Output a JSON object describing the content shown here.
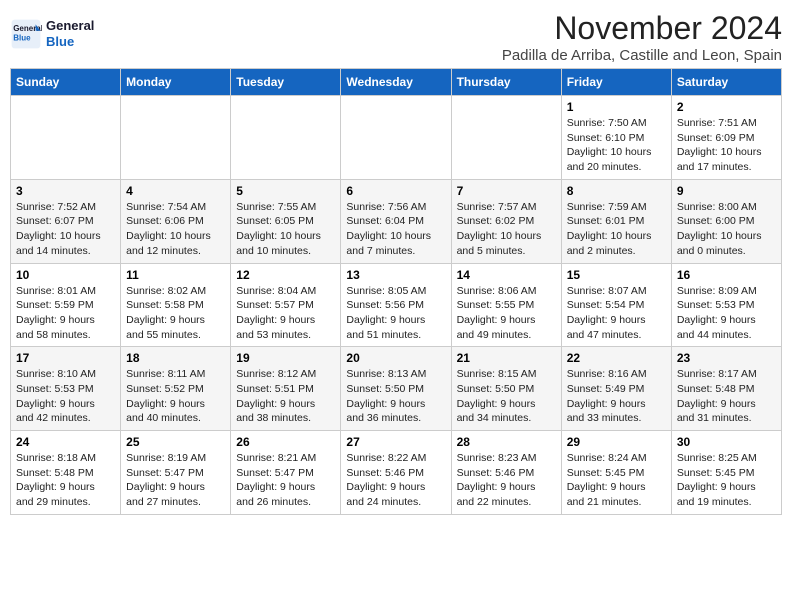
{
  "header": {
    "logo_line1": "General",
    "logo_line2": "Blue",
    "month_title": "November 2024",
    "location": "Padilla de Arriba, Castille and Leon, Spain"
  },
  "weekdays": [
    "Sunday",
    "Monday",
    "Tuesday",
    "Wednesday",
    "Thursday",
    "Friday",
    "Saturday"
  ],
  "weeks": [
    [
      {
        "day": "",
        "info": ""
      },
      {
        "day": "",
        "info": ""
      },
      {
        "day": "",
        "info": ""
      },
      {
        "day": "",
        "info": ""
      },
      {
        "day": "",
        "info": ""
      },
      {
        "day": "1",
        "info": "Sunrise: 7:50 AM\nSunset: 6:10 PM\nDaylight: 10 hours\nand 20 minutes."
      },
      {
        "day": "2",
        "info": "Sunrise: 7:51 AM\nSunset: 6:09 PM\nDaylight: 10 hours\nand 17 minutes."
      }
    ],
    [
      {
        "day": "3",
        "info": "Sunrise: 7:52 AM\nSunset: 6:07 PM\nDaylight: 10 hours\nand 14 minutes."
      },
      {
        "day": "4",
        "info": "Sunrise: 7:54 AM\nSunset: 6:06 PM\nDaylight: 10 hours\nand 12 minutes."
      },
      {
        "day": "5",
        "info": "Sunrise: 7:55 AM\nSunset: 6:05 PM\nDaylight: 10 hours\nand 10 minutes."
      },
      {
        "day": "6",
        "info": "Sunrise: 7:56 AM\nSunset: 6:04 PM\nDaylight: 10 hours\nand 7 minutes."
      },
      {
        "day": "7",
        "info": "Sunrise: 7:57 AM\nSunset: 6:02 PM\nDaylight: 10 hours\nand 5 minutes."
      },
      {
        "day": "8",
        "info": "Sunrise: 7:59 AM\nSunset: 6:01 PM\nDaylight: 10 hours\nand 2 minutes."
      },
      {
        "day": "9",
        "info": "Sunrise: 8:00 AM\nSunset: 6:00 PM\nDaylight: 10 hours\nand 0 minutes."
      }
    ],
    [
      {
        "day": "10",
        "info": "Sunrise: 8:01 AM\nSunset: 5:59 PM\nDaylight: 9 hours\nand 58 minutes."
      },
      {
        "day": "11",
        "info": "Sunrise: 8:02 AM\nSunset: 5:58 PM\nDaylight: 9 hours\nand 55 minutes."
      },
      {
        "day": "12",
        "info": "Sunrise: 8:04 AM\nSunset: 5:57 PM\nDaylight: 9 hours\nand 53 minutes."
      },
      {
        "day": "13",
        "info": "Sunrise: 8:05 AM\nSunset: 5:56 PM\nDaylight: 9 hours\nand 51 minutes."
      },
      {
        "day": "14",
        "info": "Sunrise: 8:06 AM\nSunset: 5:55 PM\nDaylight: 9 hours\nand 49 minutes."
      },
      {
        "day": "15",
        "info": "Sunrise: 8:07 AM\nSunset: 5:54 PM\nDaylight: 9 hours\nand 47 minutes."
      },
      {
        "day": "16",
        "info": "Sunrise: 8:09 AM\nSunset: 5:53 PM\nDaylight: 9 hours\nand 44 minutes."
      }
    ],
    [
      {
        "day": "17",
        "info": "Sunrise: 8:10 AM\nSunset: 5:53 PM\nDaylight: 9 hours\nand 42 minutes."
      },
      {
        "day": "18",
        "info": "Sunrise: 8:11 AM\nSunset: 5:52 PM\nDaylight: 9 hours\nand 40 minutes."
      },
      {
        "day": "19",
        "info": "Sunrise: 8:12 AM\nSunset: 5:51 PM\nDaylight: 9 hours\nand 38 minutes."
      },
      {
        "day": "20",
        "info": "Sunrise: 8:13 AM\nSunset: 5:50 PM\nDaylight: 9 hours\nand 36 minutes."
      },
      {
        "day": "21",
        "info": "Sunrise: 8:15 AM\nSunset: 5:50 PM\nDaylight: 9 hours\nand 34 minutes."
      },
      {
        "day": "22",
        "info": "Sunrise: 8:16 AM\nSunset: 5:49 PM\nDaylight: 9 hours\nand 33 minutes."
      },
      {
        "day": "23",
        "info": "Sunrise: 8:17 AM\nSunset: 5:48 PM\nDaylight: 9 hours\nand 31 minutes."
      }
    ],
    [
      {
        "day": "24",
        "info": "Sunrise: 8:18 AM\nSunset: 5:48 PM\nDaylight: 9 hours\nand 29 minutes."
      },
      {
        "day": "25",
        "info": "Sunrise: 8:19 AM\nSunset: 5:47 PM\nDaylight: 9 hours\nand 27 minutes."
      },
      {
        "day": "26",
        "info": "Sunrise: 8:21 AM\nSunset: 5:47 PM\nDaylight: 9 hours\nand 26 minutes."
      },
      {
        "day": "27",
        "info": "Sunrise: 8:22 AM\nSunset: 5:46 PM\nDaylight: 9 hours\nand 24 minutes."
      },
      {
        "day": "28",
        "info": "Sunrise: 8:23 AM\nSunset: 5:46 PM\nDaylight: 9 hours\nand 22 minutes."
      },
      {
        "day": "29",
        "info": "Sunrise: 8:24 AM\nSunset: 5:45 PM\nDaylight: 9 hours\nand 21 minutes."
      },
      {
        "day": "30",
        "info": "Sunrise: 8:25 AM\nSunset: 5:45 PM\nDaylight: 9 hours\nand 19 minutes."
      }
    ]
  ]
}
